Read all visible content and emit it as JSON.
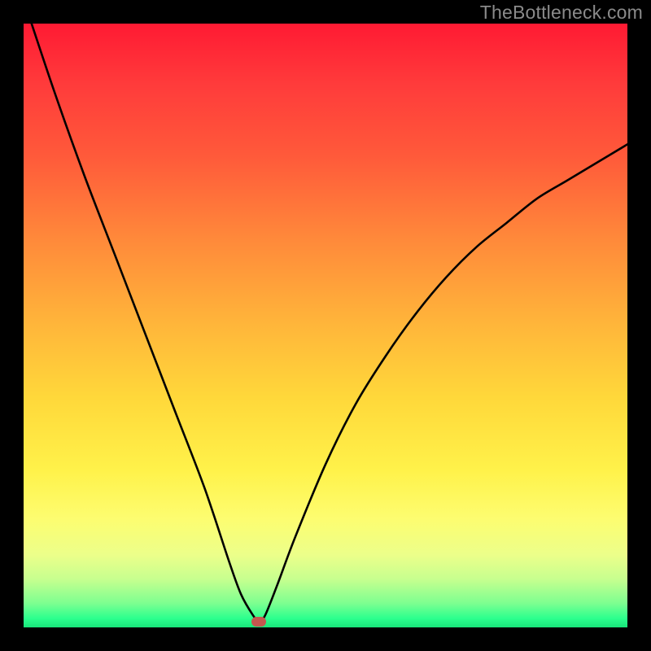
{
  "watermark": "TheBottleneck.com",
  "chart_data": {
    "type": "line",
    "title": "",
    "xlabel": "",
    "ylabel": "",
    "xlim": [
      0,
      100
    ],
    "ylim": [
      0,
      100
    ],
    "grid": false,
    "series": [
      {
        "name": "bottleneck-curve",
        "x": [
          0,
          5,
          10,
          15,
          20,
          25,
          30,
          34,
          36,
          38,
          39,
          40,
          42,
          45,
          50,
          55,
          60,
          65,
          70,
          75,
          80,
          85,
          90,
          95,
          100
        ],
        "values": [
          104,
          89,
          75,
          62,
          49,
          36,
          23,
          11,
          5.5,
          2,
          1,
          2,
          7,
          15,
          27,
          37,
          45,
          52,
          58,
          63,
          67,
          71,
          74,
          77,
          80
        ]
      }
    ],
    "annotations": [
      {
        "name": "optimum-marker",
        "x": 39,
        "y": 1
      }
    ],
    "background_gradient": {
      "direction": "top-to-bottom",
      "stops": [
        {
          "pct": 0,
          "color": "#ff1a33"
        },
        {
          "pct": 50,
          "color": "#ffb63a"
        },
        {
          "pct": 82,
          "color": "#fdfd70"
        },
        {
          "pct": 100,
          "color": "#18e57a"
        }
      ]
    }
  }
}
